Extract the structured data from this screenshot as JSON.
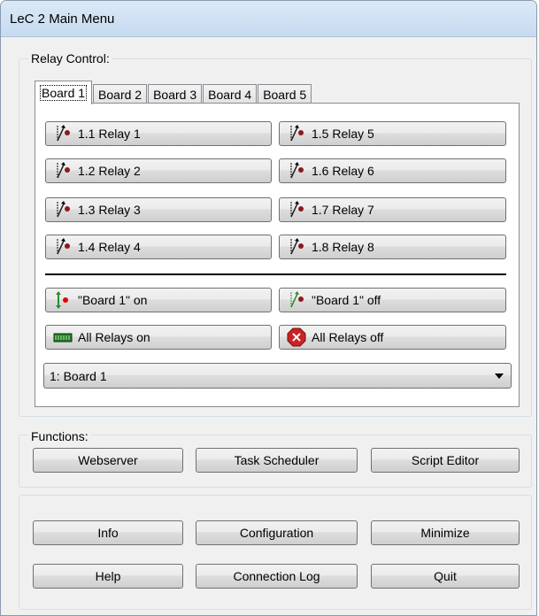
{
  "window": {
    "title": "LeC 2 Main Menu"
  },
  "relay_control": {
    "label": "Relay Control:",
    "tabs": [
      {
        "label": "Board 1",
        "active": true
      },
      {
        "label": "Board 2",
        "active": false
      },
      {
        "label": "Board 3",
        "active": false
      },
      {
        "label": "Board 4",
        "active": false
      },
      {
        "label": "Board 5",
        "active": false
      }
    ],
    "relays": [
      {
        "label": "1.1 Relay 1",
        "icon": "relay-switch-icon"
      },
      {
        "label": "1.2 Relay 2",
        "icon": "relay-switch-icon"
      },
      {
        "label": "1.3 Relay 3",
        "icon": "relay-switch-icon"
      },
      {
        "label": "1.4 Relay 4",
        "icon": "relay-switch-icon"
      },
      {
        "label": "1.5 Relay 5",
        "icon": "relay-switch-icon"
      },
      {
        "label": "1.6 Relay 6",
        "icon": "relay-switch-icon"
      },
      {
        "label": "1.7 Relay 7",
        "icon": "relay-switch-icon"
      },
      {
        "label": "1.8 Relay 8",
        "icon": "relay-switch-icon"
      }
    ],
    "board_on_label": "\"Board 1\" on",
    "board_off_label": "\"Board 1\" off",
    "all_on_label": "All Relays on",
    "all_off_label": "All Relays off",
    "board_select_value": "1: Board 1"
  },
  "functions": {
    "label": "Functions:",
    "webserver": "Webserver",
    "task_scheduler": "Task Scheduler",
    "script_editor": "Script Editor"
  },
  "bottom": {
    "info": "Info",
    "configuration": "Configuration",
    "minimize": "Minimize",
    "help": "Help",
    "connection_log": "Connection Log",
    "quit": "Quit"
  },
  "colors": {
    "relay_dot": "#8b1a1a",
    "relay_switch_on_dot": "#e00000",
    "relay_switch_on_arm": "#2e8b2e",
    "all_on_icon": "#1f7a1f",
    "all_off_icon": "#cc2222"
  }
}
